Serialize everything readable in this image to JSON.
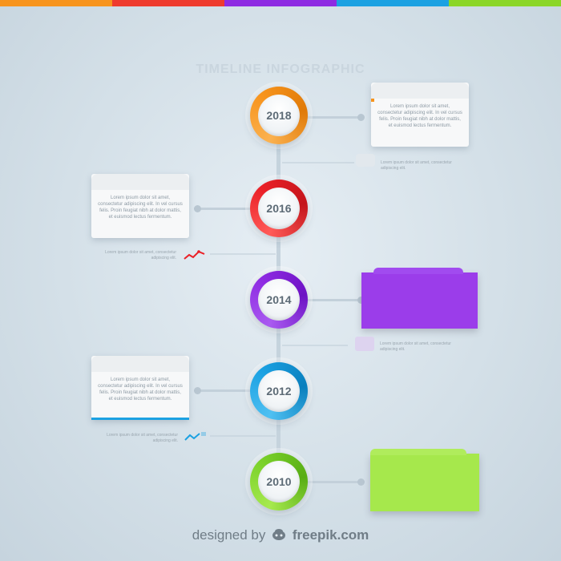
{
  "top_stripe_colors": [
    "#f7941d",
    "#ee3b2e",
    "#8e2be2",
    "#1ba1e2",
    "#8bd628"
  ],
  "title": "TIMELINE INFOGRAPHIC",
  "lorem_card": "Lorem ipsum dolor sit amet, consectetur adipiscing elit. In vel cursus felis. Proin feugiat nibh at dolor mattis, et euismod lectus fermentum.",
  "lorem_note": "Lorem ipsum dolor sit amet, consectetur adipiscing elit.",
  "milestones": [
    {
      "year": "2018",
      "color": "#f7941d",
      "light": "#fbb14f"
    },
    {
      "year": "2016",
      "color": "#ea2027",
      "light": "#ff5a57"
    },
    {
      "year": "2014",
      "color": "#8e2be2",
      "light": "#a95af0"
    },
    {
      "year": "2012",
      "color": "#1ba1e2",
      "light": "#4fc0f2"
    },
    {
      "year": "2010",
      "color": "#7ad12a",
      "light": "#a6e94e"
    }
  ],
  "footer": {
    "prefix": "designed by",
    "brand": "freepik.com",
    "icon": "freepik-logo-icon"
  }
}
